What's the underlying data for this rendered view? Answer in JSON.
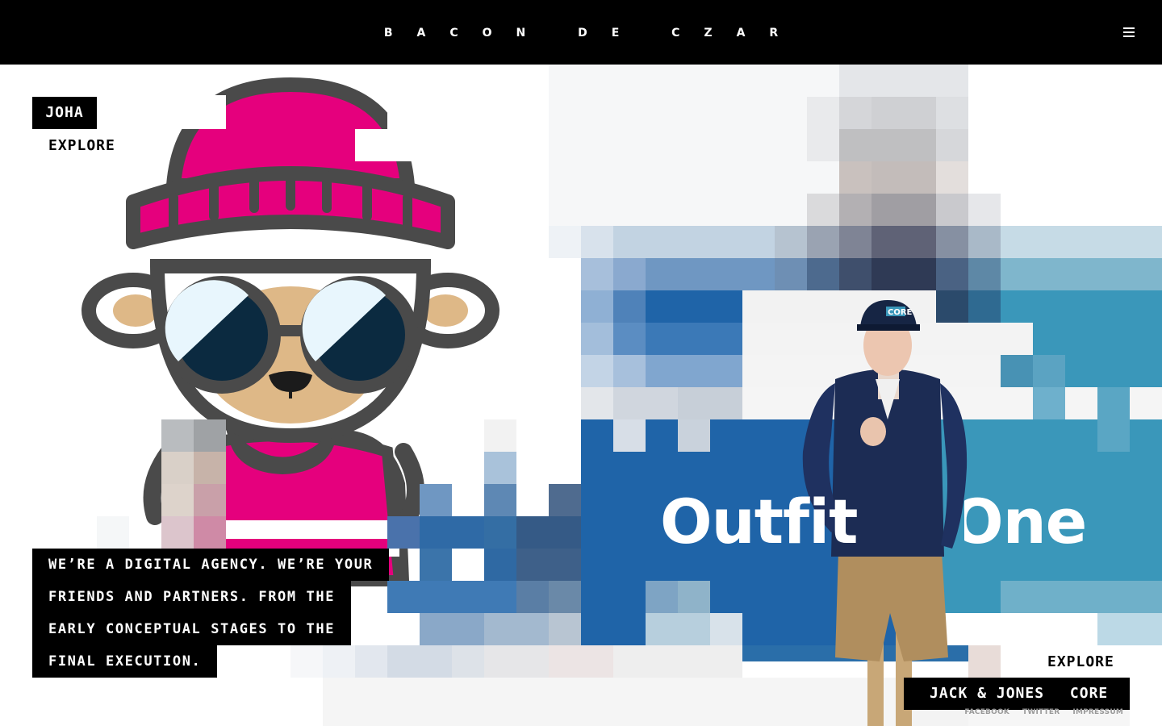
{
  "header": {
    "logo": "BACON DE CZAR",
    "menu_icon": "hamburger-menu-icon"
  },
  "colors": {
    "topbar": "#000000",
    "hat_pink": "#e5007d",
    "outline_gray": "#4a4a4a",
    "lens_navy": "#0b2a40",
    "brand_blue": "#1f64a8",
    "brand_teal": "#3a97ba"
  },
  "left_project": {
    "title": "JOHA",
    "explore": "EXPLORE"
  },
  "intro": {
    "text": "WE’RE A DIGITAL AGENCY. WE’RE YOUR FRIENDS AND PARTNERS. FROM THE EARLY CONCEPTUAL STAGES TO THE FINAL EXECUTION."
  },
  "right_project": {
    "headline_left": "Outfit",
    "headline_right": "One",
    "cap_text": "CORE",
    "explore": "EXPLORE",
    "title": "JACK & JONES",
    "title_suffix": "CORE"
  },
  "footer": {
    "links": [
      "FACEBOOK",
      "TWITTER",
      "IMPRESSUM"
    ]
  }
}
